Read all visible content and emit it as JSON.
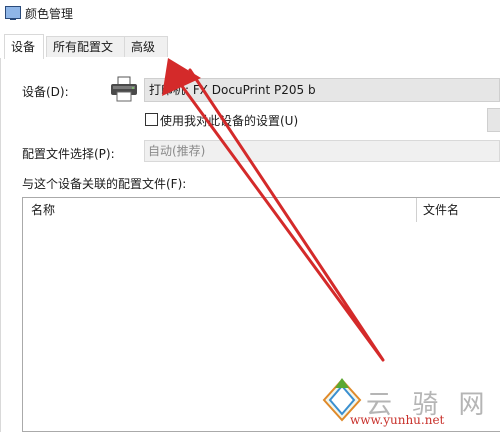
{
  "window": {
    "title": "颜色管理"
  },
  "tabs": [
    {
      "label": "设备",
      "active": true
    },
    {
      "label": "所有配置文件",
      "active": false
    },
    {
      "label": "高级",
      "active": false
    }
  ],
  "device": {
    "label": "设备(D):",
    "value": "打印机: FX DocuPrint P205 b",
    "icon": "printer-icon"
  },
  "use_settings": {
    "label": "使用我对此设备的设置(U)",
    "checked": false
  },
  "profile_select": {
    "label": "配置文件选择(P):",
    "value": "自动(推荐)"
  },
  "associated": {
    "label": "与这个设备关联的配置文件(F):",
    "columns": [
      "名称",
      "文件名"
    ]
  },
  "watermark": {
    "brand_text": "云 骑 网",
    "url": "www.yunhu.net"
  },
  "colors": {
    "arrow": "#d42a2a",
    "selected_tab_bg": "#ffffff",
    "field_bg": "#e6e6e6"
  }
}
